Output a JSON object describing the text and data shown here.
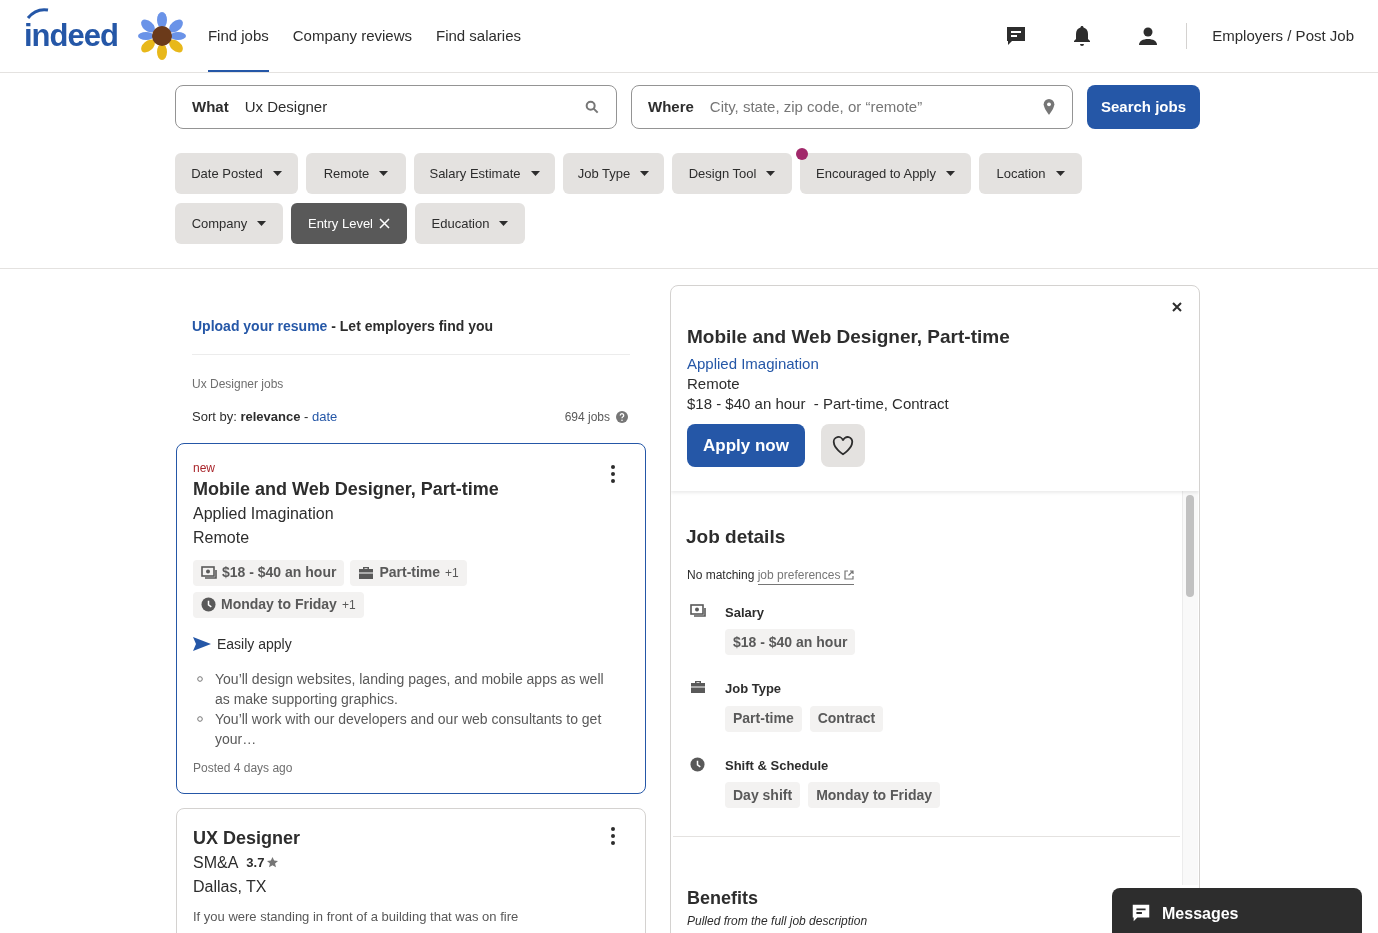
{
  "header": {
    "logo": "indeed",
    "nav": [
      {
        "label": "Find jobs",
        "selected": true
      },
      {
        "label": "Company reviews",
        "selected": false
      },
      {
        "label": "Find salaries",
        "selected": false
      }
    ],
    "employers_link": "Employers / Post Job"
  },
  "search": {
    "what": {
      "label": "What",
      "value": "Ux Designer"
    },
    "where": {
      "label": "Where",
      "placeholder": "City, state, zip code, or “remote”"
    },
    "button": "Search jobs"
  },
  "filters": [
    {
      "label": "Date Posted",
      "selected": false,
      "notification": false
    },
    {
      "label": "Remote",
      "selected": false,
      "notification": false
    },
    {
      "label": "Salary Estimate",
      "selected": false,
      "notification": false
    },
    {
      "label": "Job Type",
      "selected": false,
      "notification": false
    },
    {
      "label": "Design Tool",
      "selected": false,
      "notification": false
    },
    {
      "label": "Encouraged to Apply",
      "selected": false,
      "notification": true
    },
    {
      "label": "Location",
      "selected": false,
      "notification": false
    },
    {
      "label": "Company",
      "selected": false,
      "notification": false
    },
    {
      "label": "Entry Level",
      "selected": true,
      "notification": false
    },
    {
      "label": "Education",
      "selected": false,
      "notification": false
    }
  ],
  "resume_banner": {
    "link": "Upload your resume",
    "text": " - Let employers find you"
  },
  "results": {
    "heading": "Ux Designer jobs",
    "sort_text": "Sort by: **relevance** - ",
    "sort_link": "date",
    "count": "694 jobs"
  },
  "jobs": [
    {
      "selected": true,
      "badge": "new",
      "title": "Mobile and Web Designer, Part-time",
      "company": "Applied Imagination",
      "location": "Remote",
      "tags": [
        {
          "kind": "salary",
          "text": "$18 - $40 an hour"
        },
        {
          "kind": "job_type",
          "text": "Part-time",
          "extra": "+1"
        },
        {
          "kind": "schedule",
          "text": "Monday to Friday",
          "extra": "+1"
        }
      ],
      "easily_apply": "Easily apply",
      "snippet": [
        "You’ll design websites, landing pages, and mobile apps as well as make supporting graphics.",
        "You’ll work with our developers and our web consultants to get your…"
      ],
      "posted": "Posted 4 days ago"
    },
    {
      "selected": false,
      "title": "UX Designer",
      "company": "SM&A",
      "rating": "3.7",
      "location": "Dallas, TX",
      "snippet_text": "If you were standing in front of a building that was on fire"
    }
  ],
  "detail": {
    "title": "Mobile and Web Designer, Part-time",
    "company": "Applied Imagination",
    "location": "Remote",
    "pay_line": "$18 - $40 an hour  - Part-time, Contract",
    "apply": "Apply now",
    "job_details": {
      "heading": "Job details",
      "prefs_text": "No matching ",
      "prefs_link": "job preferences",
      "sections": [
        {
          "kind": "salary",
          "label": "Salary",
          "tags": [
            "$18 - $40 an hour"
          ]
        },
        {
          "kind": "job_type",
          "label": "Job Type",
          "tags": [
            "Part-time",
            "Contract"
          ]
        },
        {
          "kind": "schedule",
          "label": "Shift & Schedule",
          "tags": [
            "Day shift",
            "Monday to Friday"
          ]
        }
      ]
    },
    "benefits": {
      "heading": "Benefits",
      "subtitle": "Pulled from the full job description"
    }
  },
  "messages": "Messages"
}
